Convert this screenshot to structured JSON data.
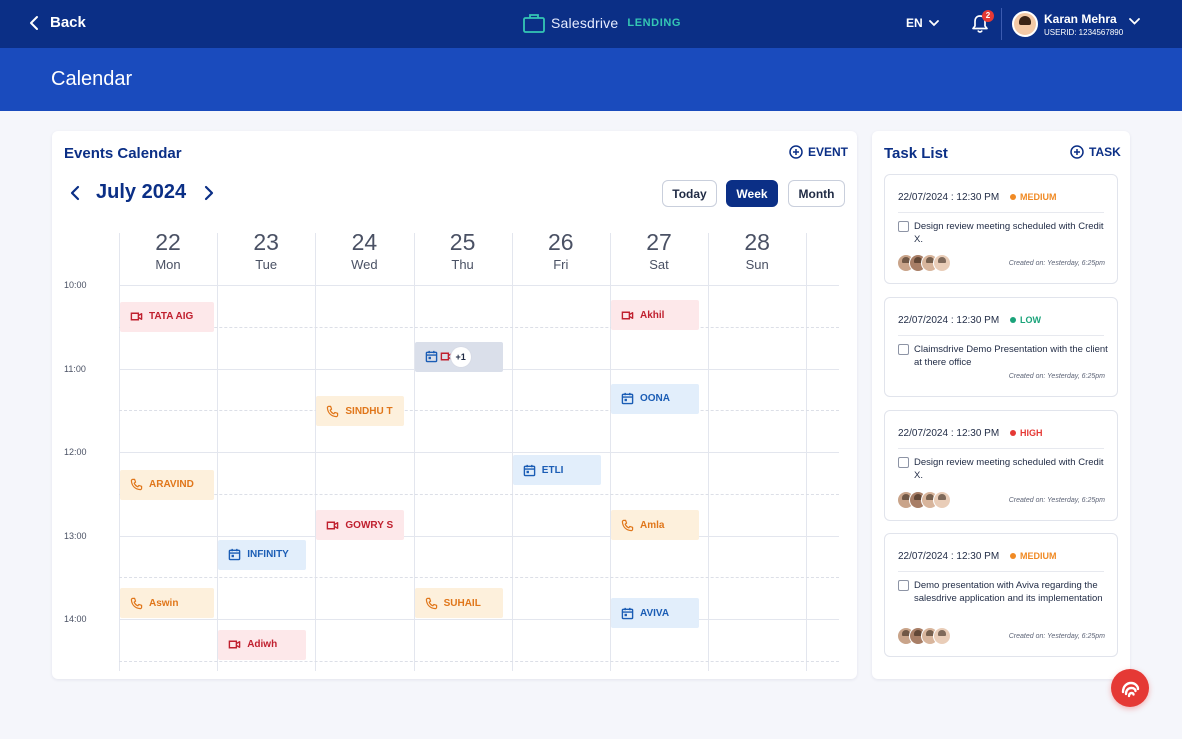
{
  "header": {
    "back_label": "Back",
    "brand_name": "Salesdrive",
    "brand_tag": "LENDING",
    "language": "EN",
    "notifications_count": "2",
    "user_name": "Karan Mehra",
    "user_id": "USERID: 1234567890"
  },
  "page_title": "Calendar",
  "events": {
    "title": "Events Calendar",
    "add_label": "EVENT",
    "month_label": "July 2024",
    "views": [
      "Today",
      "Week",
      "Month"
    ],
    "active_view": "Week",
    "days": [
      {
        "num": "22",
        "name": "Mon"
      },
      {
        "num": "23",
        "name": "Tue"
      },
      {
        "num": "24",
        "name": "Wed"
      },
      {
        "num": "25",
        "name": "Thu"
      },
      {
        "num": "26",
        "name": "Fri"
      },
      {
        "num": "27",
        "name": "Sat"
      },
      {
        "num": "28",
        "name": "Sun"
      }
    ],
    "times": [
      "10:00",
      "11:00",
      "12:00",
      "13:00",
      "14:00"
    ],
    "items": [
      {
        "label": "TATA AIG",
        "type": "video",
        "day": 0,
        "time": 10.2
      },
      {
        "label": "Akhil",
        "type": "video",
        "day": 5,
        "time": 10.18
      },
      {
        "label": "+1",
        "type": "multi",
        "day": 3,
        "time": 10.68
      },
      {
        "label": "OONA",
        "type": "meet",
        "day": 5,
        "time": 11.18
      },
      {
        "label": "SINDHU T",
        "type": "call",
        "day": 2,
        "time": 11.33
      },
      {
        "label": "ETLI",
        "type": "meet",
        "day": 4,
        "time": 12.04
      },
      {
        "label": "ARAVIND",
        "type": "call",
        "day": 0,
        "time": 12.21
      },
      {
        "label": "GOWRY S",
        "type": "video",
        "day": 2,
        "time": 12.7
      },
      {
        "label": "Amla",
        "type": "call",
        "day": 5,
        "time": 12.7
      },
      {
        "label": "INFINITY",
        "type": "meet",
        "day": 1,
        "time": 13.05
      },
      {
        "label": "Aswin",
        "type": "call",
        "day": 0,
        "time": 13.63
      },
      {
        "label": "SUHAIL",
        "type": "call",
        "day": 3,
        "time": 13.63
      },
      {
        "label": "AVIVA",
        "type": "meet",
        "day": 5,
        "time": 13.75
      },
      {
        "label": "Adiwh",
        "type": "video",
        "day": 1,
        "time": 14.13
      }
    ]
  },
  "tasks": {
    "title": "Task List",
    "add_label": "TASK",
    "items": [
      {
        "date": "22/07/2024 : 12:30 PM",
        "priority": "MEDIUM",
        "priority_color": "#f08a24",
        "desc": "Design review meeting scheduled with Credit X.",
        "created": "Created on: Yesterday, 6:25pm",
        "has_avatars": true
      },
      {
        "date": "22/07/2024 : 12:30 PM",
        "priority": "LOW",
        "priority_color": "#1aa37a",
        "desc": "Claimsdrive Demo Presentation with the client at there office",
        "created": "Created on: Yesterday, 6:25pm",
        "has_avatars": false
      },
      {
        "date": "22/07/2024 : 12:30 PM",
        "priority": "HIGH",
        "priority_color": "#e53935",
        "desc": "Design review meeting scheduled with Credit X.",
        "created": "Created on: Yesterday, 6:25pm",
        "has_avatars": true
      },
      {
        "date": "22/07/2024 : 12:30 PM",
        "priority": "MEDIUM",
        "priority_color": "#f08a24",
        "desc": "Demo presentation with Aviva regarding the salesdrive application and its implementation",
        "created": "Created on: Yesterday, 6:25pm",
        "has_avatars": true
      }
    ]
  },
  "colors": {
    "header_bg": "#0b2f86",
    "title_bg": "#1a4bbd",
    "accent": "#0b2f86",
    "fab": "#e53935"
  }
}
